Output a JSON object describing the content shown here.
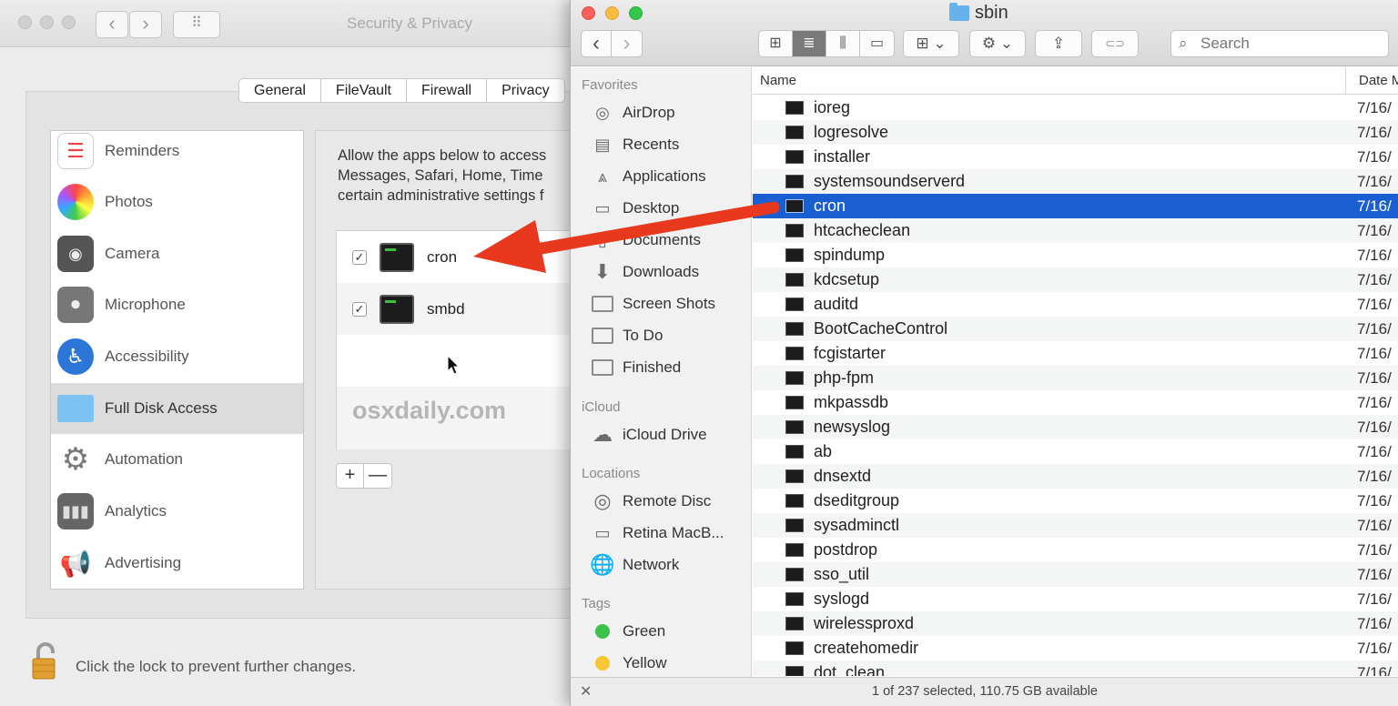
{
  "security_privacy": {
    "window_title": "Security & Privacy",
    "nav_back": "‹",
    "nav_forward": "›",
    "grid": "⠿",
    "tabs": [
      "General",
      "FileVault",
      "Firewall",
      "Privacy"
    ],
    "categories": [
      {
        "label": "Reminders",
        "icon": "reminders-icon"
      },
      {
        "label": "Photos",
        "icon": "photos-icon"
      },
      {
        "label": "Camera",
        "icon": "camera-icon"
      },
      {
        "label": "Microphone",
        "icon": "microphone-icon"
      },
      {
        "label": "Accessibility",
        "icon": "accessibility-icon"
      },
      {
        "label": "Full Disk Access",
        "icon": "folder-icon",
        "selected": true
      },
      {
        "label": "Automation",
        "icon": "gear-icon"
      },
      {
        "label": "Analytics",
        "icon": "analytics-icon"
      },
      {
        "label": "Advertising",
        "icon": "megaphone-icon"
      }
    ],
    "description_lines": [
      "Allow the apps below to access",
      "Messages, Safari, Home, Time",
      "certain administrative settings f"
    ],
    "apps": [
      {
        "name": "cron",
        "checked": true
      },
      {
        "name": "smbd",
        "checked": true
      }
    ],
    "watermark": "osxdaily.com",
    "add_label": "+",
    "remove_label": "—",
    "lock_text": "Click the lock to prevent further changes."
  },
  "finder": {
    "title": "sbin",
    "back": "‹",
    "forward": "›",
    "view_icons": [
      "⊞",
      "≣",
      "⫼",
      "▭"
    ],
    "group_btn": "⊞ ⌄",
    "action_btn": "⚙ ⌄",
    "share_btn": "⇪",
    "tag_btn": "⊂⊃",
    "search_placeholder": "Search",
    "sidebar": {
      "favorites_head": "Favorites",
      "favorites": [
        {
          "label": "AirDrop",
          "icon": "airdrop-icon"
        },
        {
          "label": "Recents",
          "icon": "recents-icon"
        },
        {
          "label": "Applications",
          "icon": "applications-icon"
        },
        {
          "label": "Desktop",
          "icon": "desktop-icon"
        },
        {
          "label": "Documents",
          "icon": "documents-icon"
        },
        {
          "label": "Downloads",
          "icon": "downloads-icon"
        },
        {
          "label": "Screen Shots",
          "icon": "folder-icon"
        },
        {
          "label": "To Do",
          "icon": "folder-icon"
        },
        {
          "label": "Finished",
          "icon": "folder-icon"
        }
      ],
      "icloud_head": "iCloud",
      "icloud": [
        {
          "label": "iCloud Drive",
          "icon": "cloud-icon"
        }
      ],
      "locations_head": "Locations",
      "locations": [
        {
          "label": "Remote Disc",
          "icon": "disc-icon"
        },
        {
          "label": "Retina MacB...",
          "icon": "laptop-icon"
        },
        {
          "label": "Network",
          "icon": "network-icon"
        }
      ],
      "tags_head": "Tags",
      "tags": [
        {
          "label": "Green",
          "color": "#3cc24a"
        },
        {
          "label": "Yellow",
          "color": "#f6c633"
        }
      ]
    },
    "columns": {
      "name": "Name",
      "date": "Date M"
    },
    "files": [
      "ioreg",
      "logresolve",
      "installer",
      "systemsoundserverd",
      "cron",
      "htcacheclean",
      "spindump",
      "kdcsetup",
      "auditd",
      "BootCacheControl",
      "fcgistarter",
      "php-fpm",
      "mkpassdb",
      "newsyslog",
      "ab",
      "dnsextd",
      "dseditgroup",
      "sysadminctl",
      "postdrop",
      "sso_util",
      "syslogd",
      "wirelessproxd",
      "createhomedir",
      "dot_clean"
    ],
    "file_date": "7/16/",
    "selected_file": "cron",
    "status": "1 of 237 selected, 110.75 GB available",
    "status_icon": "✕"
  },
  "colors": {
    "selection_blue": "#1a5fd1",
    "arrow_red": "#e8391f",
    "close_red": "#fc605c",
    "minimize_yellow": "#fdbc40",
    "zoom_green": "#34c84a"
  }
}
